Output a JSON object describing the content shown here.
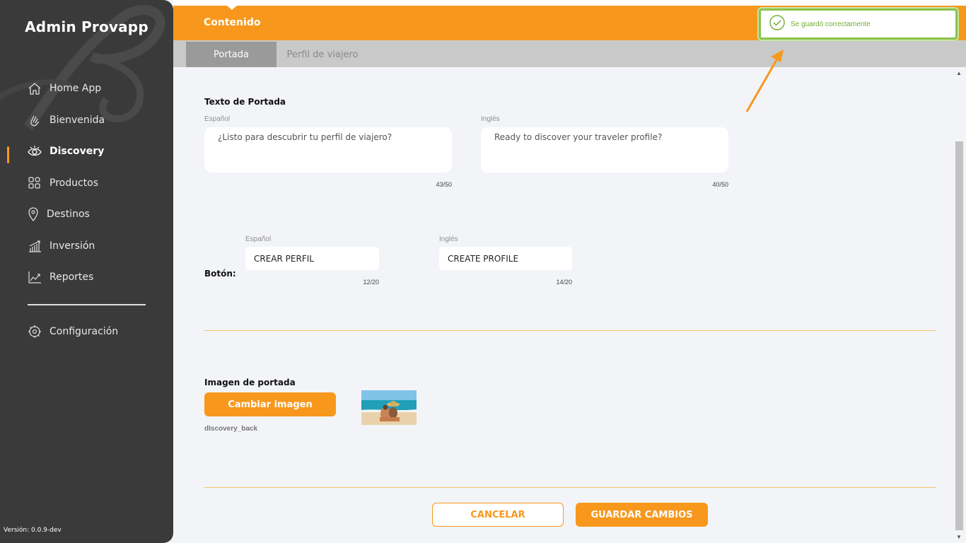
{
  "sidebar": {
    "app_title": "Admin Provapp",
    "items": [
      {
        "label": "Home App",
        "icon": "home-icon"
      },
      {
        "label": "Bienvenida",
        "icon": "waving-hand-icon"
      },
      {
        "label": "Discovery",
        "icon": "eye-icon",
        "active": true
      },
      {
        "label": "Productos",
        "icon": "grid-icon"
      },
      {
        "label": "Destinos",
        "icon": "location-pin-icon"
      },
      {
        "label": "Inversión",
        "icon": "bar-growth-icon"
      },
      {
        "label": "Reportes",
        "icon": "line-chart-icon"
      }
    ],
    "settings_label": "Configuración",
    "version": "Versión: 0.0.9-dev"
  },
  "header": {
    "title": "Contenido"
  },
  "tabs": [
    {
      "label": "Portada",
      "active": true
    },
    {
      "label": "Perfil de viajero",
      "active": false
    }
  ],
  "toast": {
    "message": "Se guardó correctamente"
  },
  "cover_text": {
    "section_title": "Texto de Portada",
    "spanish_label": "Español",
    "spanish_value": "¿Listo para descubrir tu perfil de viajero?",
    "spanish_counter": "43/50",
    "english_label": "Inglés",
    "english_value": "Ready to discover your traveler profile?",
    "english_counter": "40/50"
  },
  "button_text": {
    "section_title": "Botón:",
    "spanish_label": "Español",
    "spanish_value": "CREAR PERFIL",
    "spanish_counter": "12/20",
    "english_label": "Inglés",
    "english_value": "CREATE PROFILE",
    "english_counter": "14/20"
  },
  "cover_image": {
    "section_title": "Imagen de portada",
    "change_button": "Cambiar imagen",
    "filename": "dIscovery_back"
  },
  "actions": {
    "cancel": "CANCELAR",
    "save": "GUARDAR CAMBIOS"
  },
  "colors": {
    "accent": "#f7981d",
    "sidebar_bg": "#3a3a3a",
    "success": "#8bc34a"
  }
}
